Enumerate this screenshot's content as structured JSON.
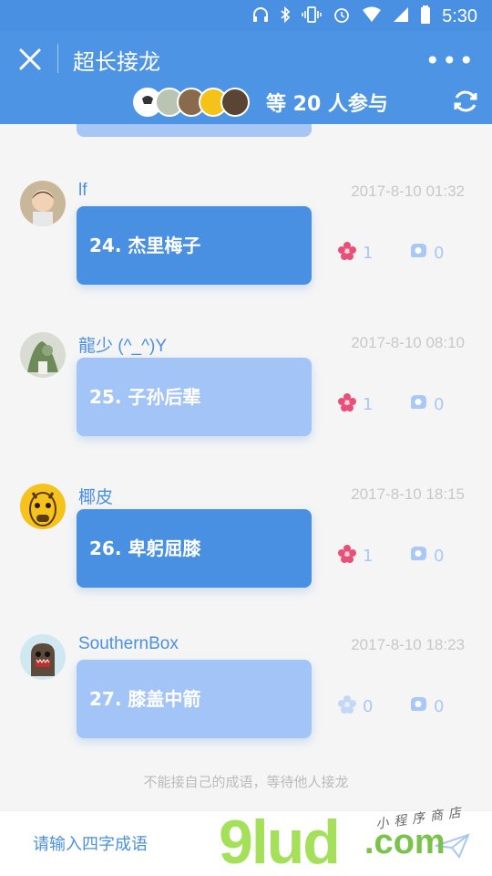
{
  "status_bar": {
    "time": "5:30"
  },
  "app_bar": {
    "title": "超长接龙",
    "participants_text": "等 20 人参与"
  },
  "entries": [
    {
      "username": "lf",
      "timestamp": "2017-8-10 01:32",
      "text": "24. 杰里梅子",
      "likes": "1",
      "comments": "0",
      "style": "dark"
    },
    {
      "username": "龍少 (^_^)Y",
      "timestamp": "2017-8-10 08:10",
      "text": "25. 子孙后辈",
      "likes": "1",
      "comments": "0",
      "style": "light"
    },
    {
      "username": "椰皮",
      "timestamp": "2017-8-10 18:15",
      "text": "26. 卑躬屈膝",
      "likes": "1",
      "comments": "0",
      "style": "dark"
    },
    {
      "username": "SouthernBox",
      "timestamp": "2017-8-10 18:23",
      "text": "27. 膝盖中箭",
      "likes": "0",
      "comments": "0",
      "style": "light"
    }
  ],
  "hint": "不能接自己的成语，等待他人接龙",
  "input": {
    "placeholder": "请输入四字成语",
    "value": ""
  },
  "watermark": {
    "main": "9lud",
    "domain": ".com",
    "tagline": "小程序商店"
  },
  "colors": {
    "primary": "#4a90e2",
    "light_bubble": "#a3c4f6",
    "like_pink": "#e8507a",
    "muted": "#a9c8f5"
  }
}
